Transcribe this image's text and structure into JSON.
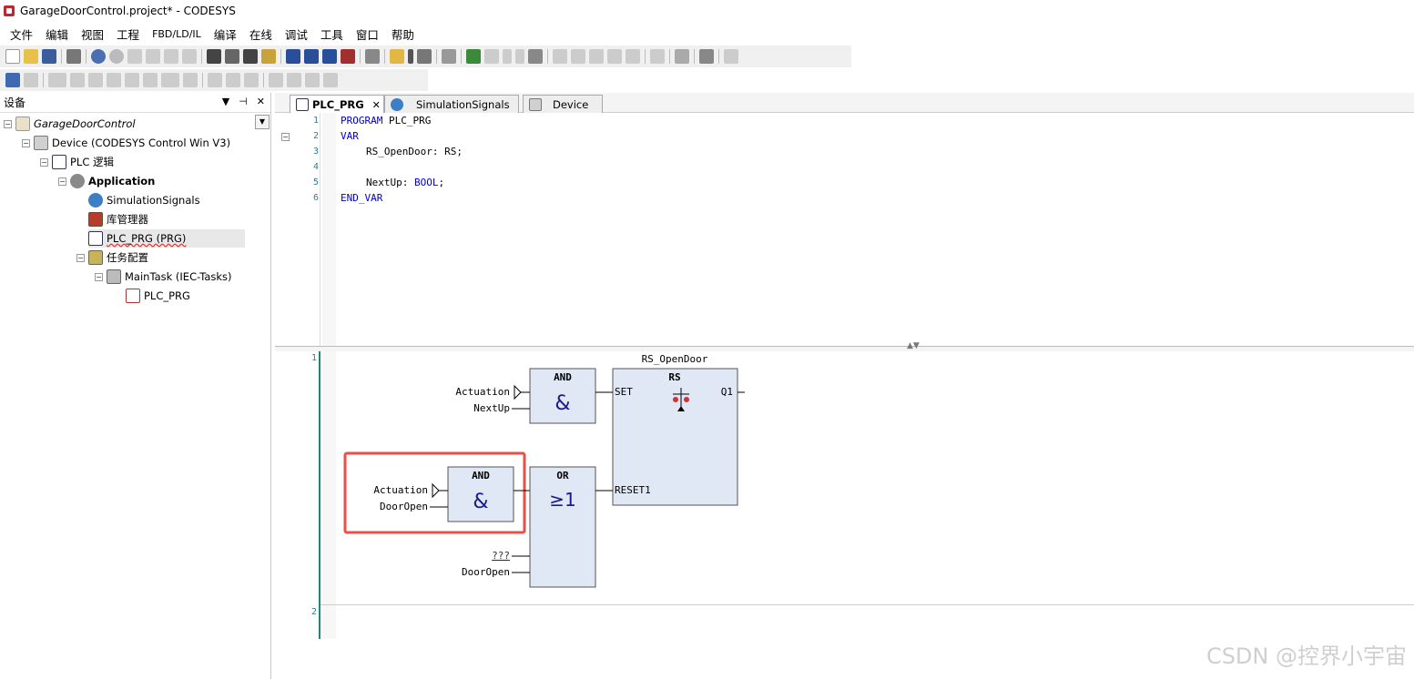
{
  "window": {
    "title": "GarageDoorControl.project* - CODESYS"
  },
  "menu": [
    "文件",
    "编辑",
    "视图",
    "工程",
    "FBD/LD/IL",
    "编译",
    "在线",
    "调试",
    "工具",
    "窗口",
    "帮助"
  ],
  "devices_panel": {
    "title": "设备",
    "tree": [
      {
        "label": "GarageDoorControl",
        "icon": "project-icon",
        "italic": true
      },
      {
        "label": "Device (CODESYS Control Win V3)",
        "icon": "device-icon"
      },
      {
        "label": "PLC 逻辑",
        "icon": "plc-logic-icon"
      },
      {
        "label": "Application",
        "icon": "application-gear-icon",
        "bold": true
      },
      {
        "label": "SimulationSignals",
        "icon": "globe-icon"
      },
      {
        "label": "库管理器",
        "icon": "library-icon"
      },
      {
        "label": "PLC_PRG (PRG)",
        "icon": "program-icon"
      },
      {
        "label": "任务配置",
        "icon": "task-config-icon"
      },
      {
        "label": "MainTask (IEC-Tasks)",
        "icon": "task-icon"
      },
      {
        "label": "PLC_PRG",
        "icon": "program-call-icon"
      }
    ]
  },
  "tabs": [
    {
      "label": "PLC_PRG",
      "icon": "program-icon",
      "active": true
    },
    {
      "label": "SimulationSignals",
      "icon": "globe-icon"
    },
    {
      "label": "Device",
      "icon": "device-icon"
    }
  ],
  "declaration": {
    "line_numbers": [
      "1",
      "2",
      "3",
      "4",
      "5",
      "6"
    ],
    "lines": [
      {
        "kw": "PROGRAM",
        "rest": " PLC_PRG"
      },
      {
        "kw": "VAR",
        "rest": ""
      },
      {
        "kw": "",
        "rest": "RS_OpenDoor: RS;"
      },
      {
        "kw": "",
        "rest": ""
      },
      {
        "kw": "",
        "rest": "NextUp: BOOL;"
      },
      {
        "kw": "END_VAR",
        "rest": ""
      }
    ],
    "bool_kw": "BOOL"
  },
  "fbd": {
    "network_numbers": [
      "1",
      "2"
    ],
    "instance_name": "RS_OpenDoor",
    "rs_block": {
      "type": "RS",
      "inputs": [
        "SET",
        "RESET1"
      ],
      "output": "Q1"
    },
    "and_block_1": {
      "type": "AND",
      "symbol": "&",
      "inputs": [
        "Actuation",
        "NextUp"
      ]
    },
    "and_block_2": {
      "type": "AND",
      "symbol": "&",
      "inputs": [
        "Actuation",
        "DoorOpen"
      ]
    },
    "or_block": {
      "type": "OR",
      "symbol": "≥1",
      "inputs": [
        "???",
        "DoorOpen"
      ]
    },
    "highlight_color": "#e8504a"
  },
  "watermark": "CSDN @控界小宇宙"
}
